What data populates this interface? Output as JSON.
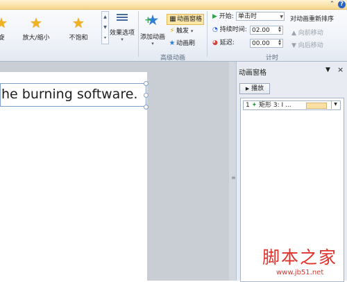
{
  "ribbon": {
    "gallery": [
      {
        "label": "旋",
        "icon": "spin-star-icon"
      },
      {
        "label": "放大/缩小",
        "icon": "grow-shrink-star-icon"
      },
      {
        "label": "不饱和",
        "icon": "desaturate-star-icon"
      }
    ],
    "effect_options": "效果选项",
    "add_animation": "添加动画",
    "animation_pane": "动画窗格",
    "trigger": "触发",
    "animation_painter": "动画刷",
    "advanced_group": "高级动画",
    "start_label": "开始:",
    "start_value": "单击时",
    "duration_label": "持续时间:",
    "duration_value": "02.00",
    "delay_label": "延迟:",
    "delay_value": "00.00",
    "timing_group": "计时",
    "reorder_title": "对动画重新排序",
    "move_earlier": "向前移动",
    "move_later": "向后移动"
  },
  "slide": {
    "text": "he burning software."
  },
  "pane": {
    "title": "动画窗格",
    "play": "播放",
    "items": [
      {
        "number": "1",
        "label": "矩形 3: I ..."
      }
    ]
  },
  "watermark": {
    "text": "脚本之家",
    "url": "www.jb51.net"
  }
}
